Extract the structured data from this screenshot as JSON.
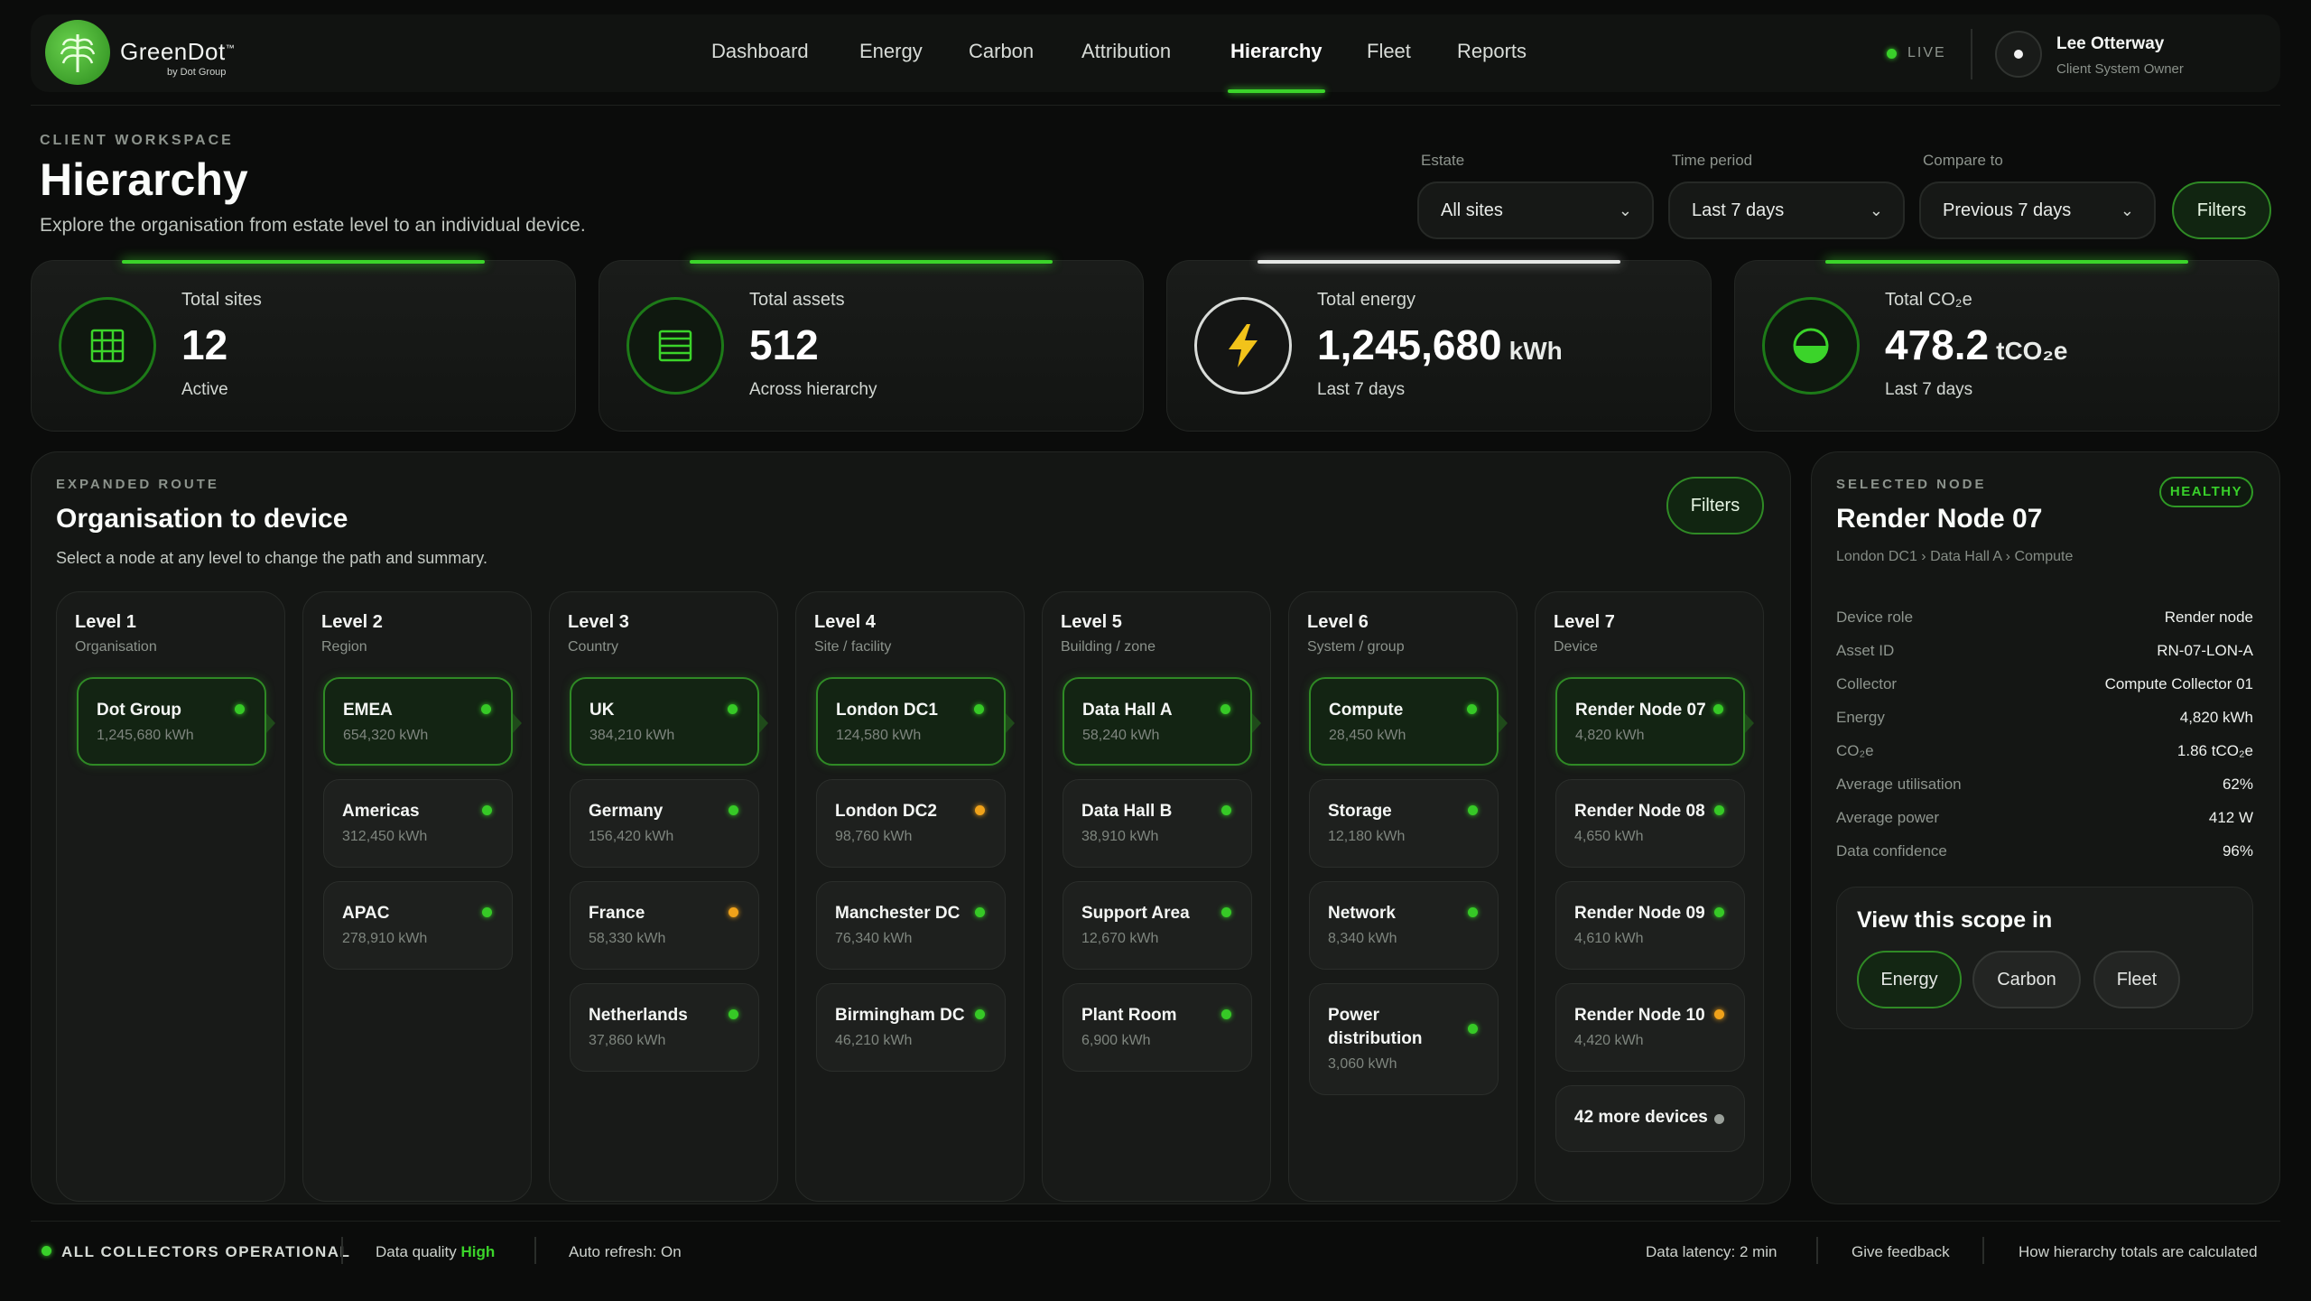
{
  "brand": {
    "name": "GreenDot",
    "tm": "™",
    "sub": "by Dot Group"
  },
  "nav": {
    "items": [
      "Dashboard",
      "Energy",
      "Carbon",
      "Attribution",
      "Hierarchy",
      "Fleet",
      "Reports"
    ],
    "active": "Hierarchy"
  },
  "status": {
    "live": "LIVE"
  },
  "user": {
    "name": "Lee Otterway",
    "role": "Client System Owner"
  },
  "header": {
    "eyebrow": "CLIENT WORKSPACE",
    "title": "Hierarchy",
    "description": "Explore the organisation from estate level to an individual device."
  },
  "controls": {
    "estate": {
      "label": "Estate",
      "value": "All sites"
    },
    "period": {
      "label": "Time period",
      "value": "Last 7 days"
    },
    "compare": {
      "label": "Compare to",
      "value": "Previous 7 days"
    },
    "filters": "Filters"
  },
  "kpis": [
    {
      "label": "Total sites",
      "value": "12",
      "unit": "",
      "sub": "Active",
      "icon": "grid-icon"
    },
    {
      "label": "Total assets",
      "value": "512",
      "unit": "",
      "sub": "Across hierarchy",
      "icon": "server-icon"
    },
    {
      "label": "Total energy",
      "value": "1,245,680",
      "unit": "kWh",
      "sub": "Last 7 days",
      "icon": "lightning-icon"
    },
    {
      "label": "Total CO₂e",
      "value": "478.2",
      "unit": "tCO₂e",
      "sub": "Last 7 days",
      "icon": "carbon-icon"
    }
  ],
  "route": {
    "eyebrow": "EXPANDED ROUTE",
    "title": "Organisation to device",
    "description": "Select a node at any level to change the path and summary.",
    "filters": "Filters",
    "levels": [
      {
        "title": "Level 1",
        "sub": "Organisation",
        "nodes": [
          {
            "name": "Dot Group",
            "value": "1,245,680 kWh",
            "status": "green",
            "selected": true
          }
        ]
      },
      {
        "title": "Level 2",
        "sub": "Region",
        "nodes": [
          {
            "name": "EMEA",
            "value": "654,320 kWh",
            "status": "green",
            "selected": true
          },
          {
            "name": "Americas",
            "value": "312,450 kWh",
            "status": "green"
          },
          {
            "name": "APAC",
            "value": "278,910 kWh",
            "status": "green"
          }
        ]
      },
      {
        "title": "Level 3",
        "sub": "Country",
        "nodes": [
          {
            "name": "UK",
            "value": "384,210 kWh",
            "status": "green",
            "selected": true
          },
          {
            "name": "Germany",
            "value": "156,420 kWh",
            "status": "green"
          },
          {
            "name": "France",
            "value": "58,330 kWh",
            "status": "amber"
          },
          {
            "name": "Netherlands",
            "value": "37,860 kWh",
            "status": "green"
          }
        ]
      },
      {
        "title": "Level 4",
        "sub": "Site / facility",
        "nodes": [
          {
            "name": "London DC1",
            "value": "124,580 kWh",
            "status": "green",
            "selected": true
          },
          {
            "name": "London DC2",
            "value": "98,760 kWh",
            "status": "amber"
          },
          {
            "name": "Manchester DC",
            "value": "76,340 kWh",
            "status": "green"
          },
          {
            "name": "Birmingham DC",
            "value": "46,210 kWh",
            "status": "green"
          }
        ]
      },
      {
        "title": "Level 5",
        "sub": "Building / zone",
        "nodes": [
          {
            "name": "Data Hall A",
            "value": "58,240 kWh",
            "status": "green",
            "selected": true
          },
          {
            "name": "Data Hall B",
            "value": "38,910 kWh",
            "status": "green"
          },
          {
            "name": "Support Area",
            "value": "12,670 kWh",
            "status": "green"
          },
          {
            "name": "Plant Room",
            "value": "6,900 kWh",
            "status": "green"
          }
        ]
      },
      {
        "title": "Level 6",
        "sub": "System / group",
        "nodes": [
          {
            "name": "Compute",
            "value": "28,450 kWh",
            "status": "green",
            "selected": true
          },
          {
            "name": "Storage",
            "value": "12,180 kWh",
            "status": "green"
          },
          {
            "name": "Network",
            "value": "8,340 kWh",
            "status": "green"
          },
          {
            "name": "Power distribution",
            "value": "3,060 kWh",
            "status": "green",
            "tall": true
          }
        ]
      },
      {
        "title": "Level 7",
        "sub": "Device",
        "nodes": [
          {
            "name": "Render Node 07",
            "value": "4,820 kWh",
            "status": "green",
            "selected": true
          },
          {
            "name": "Render Node 08",
            "value": "4,650 kWh",
            "status": "green"
          },
          {
            "name": "Render Node 09",
            "value": "4,610 kWh",
            "status": "green"
          },
          {
            "name": "Render Node 10",
            "value": "4,420 kWh",
            "status": "amber"
          },
          {
            "name": "42 more devices",
            "value": "",
            "status": "grey",
            "more": true
          }
        ]
      }
    ]
  },
  "selected": {
    "eyebrow": "SELECTED NODE",
    "badge": "HEALTHY",
    "title": "Render Node 07",
    "breadcrumb": "London DC1 › Data Hall A › Compute",
    "details": [
      {
        "key": "Device role",
        "value": "Render node"
      },
      {
        "key": "Asset ID",
        "value": "RN-07-LON-A"
      },
      {
        "key": "Collector",
        "value": "Compute Collector 01"
      },
      {
        "key": "Energy",
        "value": "4,820 kWh"
      },
      {
        "key": "CO₂e",
        "value": "1.86 tCO₂e"
      },
      {
        "key": "Average utilisation",
        "value": "62%"
      },
      {
        "key": "Average power",
        "value": "412 W"
      },
      {
        "key": "Data confidence",
        "value": "96%"
      }
    ],
    "scope": {
      "title": "View this scope in",
      "buttons": [
        "Energy",
        "Carbon",
        "Fleet"
      ]
    }
  },
  "footer": {
    "collectors": "ALL COLLECTORS OPERATIONAL",
    "quality_label": "Data quality",
    "quality_value": "High",
    "refresh": "Auto refresh: On",
    "latency": "Data latency: 2 min",
    "feedback": "Give feedback",
    "help": "How hierarchy totals are calculated"
  },
  "colors": {
    "accent": "#3bd42a",
    "amber": "#f0a21a",
    "background": "#0b0c0b"
  }
}
